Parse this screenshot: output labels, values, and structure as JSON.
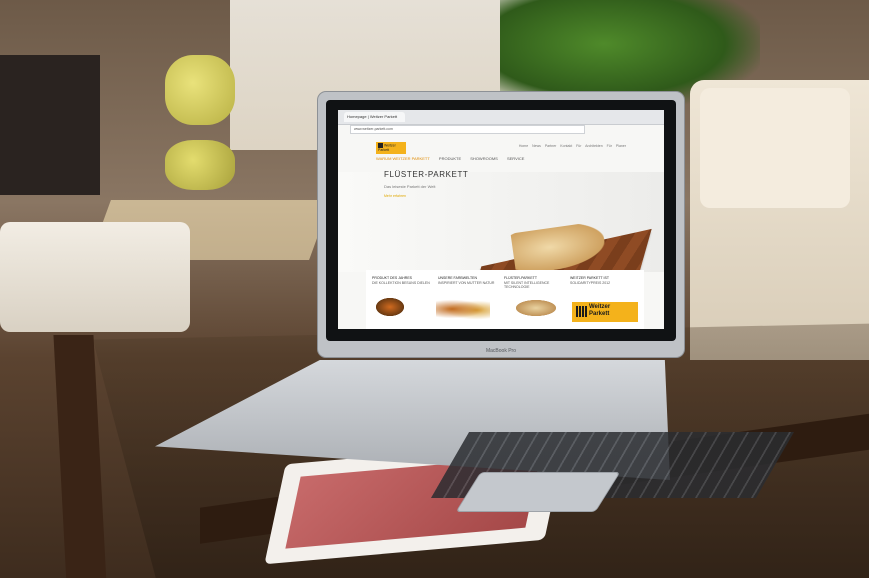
{
  "browser": {
    "tab_title": "Homepage | Weitzer Parkett",
    "url": "www.weitzer-parkett.com"
  },
  "site": {
    "logo_line1": "Weitzer",
    "logo_line2": "Parkett",
    "top_links": "Home  News  Partner  Kontakt  Für Architekten  Für Planer",
    "nav": [
      "WARUM WEITZER PARKETT",
      "PRODUKTE",
      "SHOWROOMS",
      "SERVICE"
    ],
    "hero": {
      "title": "FLÜSTER-PARKETT",
      "subtitle": "Das leiseste Parkett der Welt",
      "link": "Mehr erfahren"
    },
    "teasers": [
      {
        "title": "PRODUKT DES JAHRES",
        "text": "DIE KOLLEKTION BESUNS DIELEN"
      },
      {
        "title": "UNSERE FARBWELTEN",
        "text": "INSPIRIERT VON MUTTER NATUR"
      },
      {
        "title": "FLÜSTER-PARKETT",
        "text": "MIT SILENT INTELLIGENCE TECHNOLOGIE"
      },
      {
        "title": "WEITZER PARKETT IST",
        "text": "SOLIDARITYPREIS 2012"
      }
    ],
    "badge_line1": "Weitzer",
    "badge_line2": "Parkett"
  },
  "device": {
    "label": "MacBook Pro"
  },
  "colors": {
    "brand_yellow": "#f4b21b",
    "nav_active": "#e08a00"
  }
}
